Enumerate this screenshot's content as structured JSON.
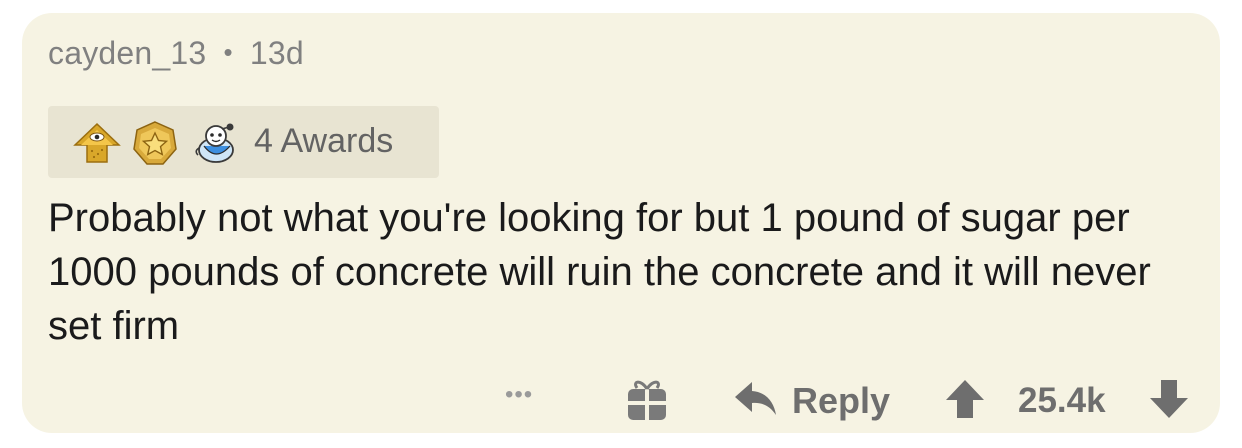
{
  "comment": {
    "author": "cayden_13",
    "separator": "•",
    "age": "13d",
    "awards": {
      "icons": [
        "all-seeing-upvote-icon",
        "gold-star-award-icon",
        "wholesome-seal-award-icon"
      ],
      "label": "4 Awards"
    },
    "body": "Probably not what you're looking for but 1 pound of sugar per 1000 pounds of concrete will ruin the concrete and it will never set firm"
  },
  "actions": {
    "more": "•••",
    "reply_label": "Reply",
    "score": "25.4k"
  },
  "colors": {
    "card_background": "#f6f3e3",
    "awards_background": "#e8e4d2",
    "meta_text": "#808080",
    "body_text": "#1a1a1b",
    "action_gray": "#6e6e6e"
  }
}
